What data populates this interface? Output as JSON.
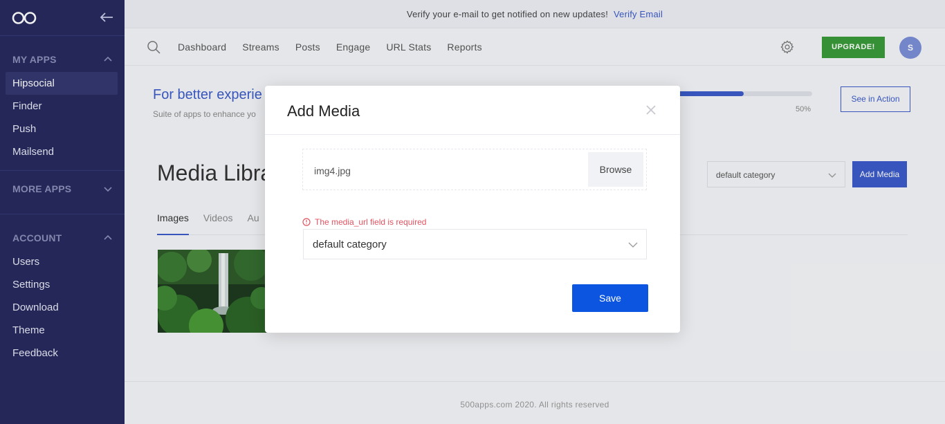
{
  "sidebar": {
    "logo": "infinity-logo",
    "sections": [
      {
        "title": "MY APPS",
        "items": [
          "Hipsocial",
          "Finder",
          "Push",
          "Mailsend"
        ],
        "active": "Hipsocial"
      },
      {
        "title": "MORE APPS",
        "items": []
      },
      {
        "title": "ACCOUNT",
        "items": [
          "Users",
          "Settings",
          "Download",
          "Theme",
          "Feedback"
        ]
      }
    ]
  },
  "verify": {
    "text": "Verify your e-mail to get notified on new updates!",
    "link": "Verify Email"
  },
  "nav": {
    "links": [
      "Dashboard",
      "Streams",
      "Posts",
      "Engage",
      "URL Stats",
      "Reports"
    ],
    "upgrade": "UPGRADE!",
    "avatar": "S"
  },
  "banner": {
    "title": "For better experie",
    "subtitle": "Suite of apps to enhance yo",
    "progress": 50,
    "progress_label": "50%",
    "action": "See in Action"
  },
  "library": {
    "title": "Media Libra",
    "category": "default category",
    "add_button": "Add Media",
    "tabs": [
      "Images",
      "Videos",
      "Au"
    ],
    "active_tab": "Images"
  },
  "footer": {
    "text": "500apps.com 2020. All rights reserved"
  },
  "modal": {
    "title": "Add Media",
    "file_name": "img4.jpg",
    "browse": "Browse",
    "error": "The media_url field is required",
    "category": "default category",
    "save": "Save"
  },
  "colors": {
    "sidebar": "#272a5e",
    "accent": "#3b5bc8",
    "save": "#0b55e0",
    "upgrade": "#3a9b3a",
    "error": "#e05260"
  }
}
